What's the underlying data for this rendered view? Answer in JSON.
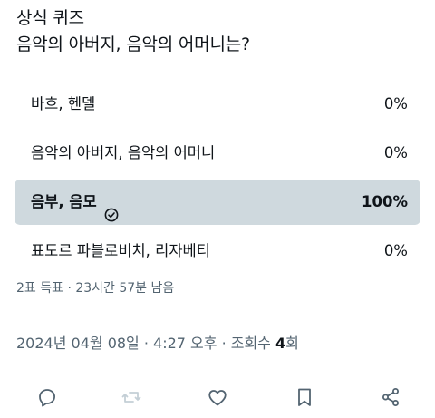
{
  "post": {
    "line1": "상식 퀴즈",
    "line2": "음악의 아버지, 음악의 어머니는?"
  },
  "poll": {
    "options": [
      {
        "label": "바흐, 헨델",
        "percent": "0%",
        "fraction": 0.0,
        "selected": false
      },
      {
        "label": "음악의 아버지, 음악의 어머니",
        "percent": "0%",
        "fraction": 0.0,
        "selected": false
      },
      {
        "label": "음부, 음모",
        "percent": "100%",
        "fraction": 1.0,
        "selected": true
      },
      {
        "label": "표도르 파블로비치, 리자베티",
        "percent": "0%",
        "fraction": 0.0,
        "selected": false
      }
    ],
    "meta": "2표 득표 · 23시간 57분 남음"
  },
  "timestamp": {
    "datetime": "2024년 04월 08일 · 4:27 오후 · 조회수 ",
    "views": "4",
    "views_suffix": "회"
  },
  "actions": {
    "icons": [
      "reply-icon",
      "retweet-icon",
      "like-icon",
      "bookmark-icon",
      "share-icon"
    ]
  },
  "colors": {
    "text": "#0f1419",
    "secondary": "#536471",
    "poll_fill": "#cfd9de",
    "retweet_disabled": "#c4cfd6"
  }
}
